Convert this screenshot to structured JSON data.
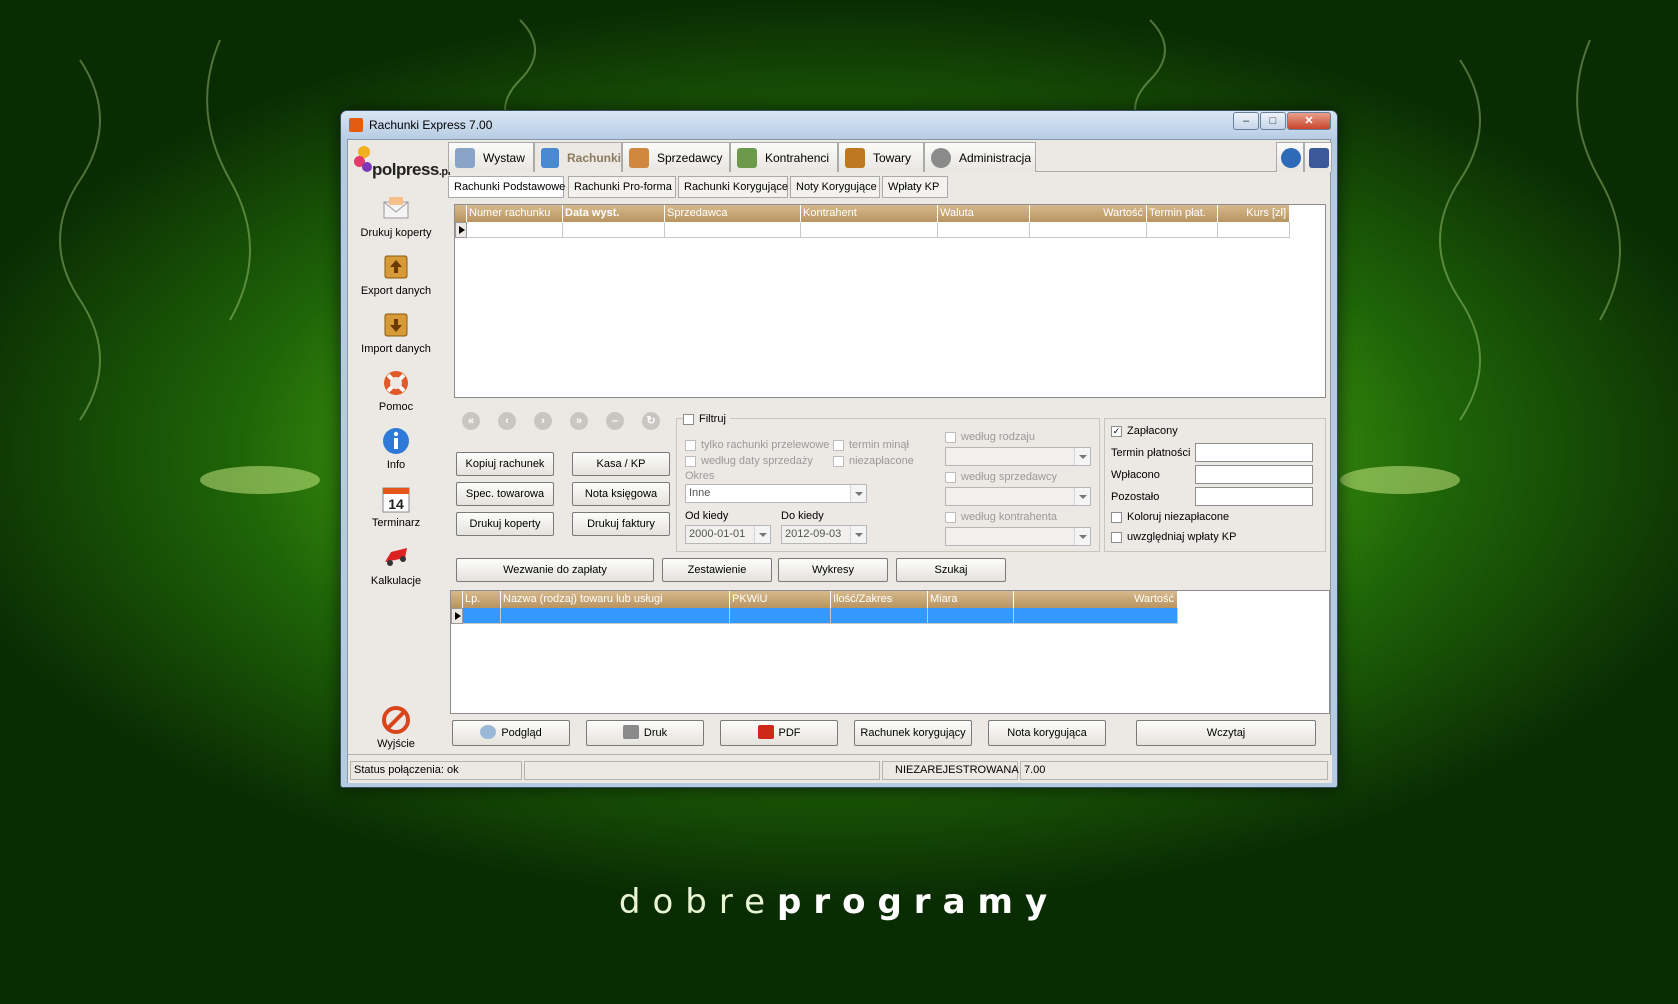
{
  "window": {
    "title": "Rachunki Express 7.00",
    "min": "–",
    "max": "□",
    "close": "✕"
  },
  "sidebar": {
    "logo": "polpress",
    "logo_suffix": ".pl",
    "items": [
      {
        "label": "Drukuj koperty",
        "icon": "envelope-icon"
      },
      {
        "label": "Export danych",
        "icon": "export-icon"
      },
      {
        "label": "Import danych",
        "icon": "import-icon"
      },
      {
        "label": "Pomoc",
        "icon": "lifebuoy-icon"
      },
      {
        "label": "Info",
        "icon": "info-icon"
      },
      {
        "label": "Terminarz",
        "icon": "calendar-icon",
        "calendar_day": "14"
      },
      {
        "label": "Kalkulacje",
        "icon": "car-icon"
      },
      {
        "label": "Wyjście",
        "icon": "exit-icon"
      }
    ]
  },
  "tabs": [
    {
      "label": "Wystaw",
      "icon": "pencil-icon",
      "color": "#8aa4c8"
    },
    {
      "label": "Rachunki",
      "icon": "book-icon",
      "color": "#4a8ad0"
    },
    {
      "label": "Sprzedawcy",
      "icon": "person-icon",
      "color": "#d08840"
    },
    {
      "label": "Kontrahenci",
      "icon": "people-icon",
      "color": "#6a9a4a"
    },
    {
      "label": "Towary",
      "icon": "box-icon",
      "color": "#c07820"
    },
    {
      "label": "Administracja",
      "icon": "gear-icon",
      "color": "#8a8a8a"
    }
  ],
  "subtabs": [
    "Rachunki Podstawowe",
    "Rachunki Pro-forma",
    "Rachunki Korygujące",
    "Noty Korygujące",
    "Wpłaty KP"
  ],
  "invoice_grid": {
    "headers": [
      "Numer rachunku",
      "Data wyst.",
      "Sprzedawca",
      "Kontrahent",
      "Waluta",
      "Wartość",
      "Termin płat.",
      "Kurs [zł]"
    ]
  },
  "nav_buttons": [
    "«",
    "‹",
    "›",
    "»",
    "–",
    "↻"
  ],
  "actions": {
    "kopiuj": "Kopiuj rachunek",
    "kasa": "Kasa / KP",
    "spec": "Spec. towarowa",
    "nota": "Nota księgowa",
    "koperty": "Drukuj koperty",
    "faktury": "Drukuj faktury",
    "wezwanie": "Wezwanie do zapłaty",
    "zestawienie": "Zestawienie",
    "wykresy": "Wykresy",
    "szukaj": "Szukaj"
  },
  "filter": {
    "title": "Filtruj",
    "tylko_przelewowe": "tylko rachunki przelewowe",
    "termin_minal": "termin minął",
    "wg_daty": "według daty sprzedaży",
    "niezaplacone": "niezapłacone",
    "okres_label": "Okres",
    "okres_value": "Inne",
    "od_label": "Od kiedy",
    "od_value": "2000-01-01",
    "do_label": "Do kiedy",
    "do_value": "2012-09-03",
    "wg_rodzaju": "według rodzaju",
    "wg_sprzedawcy": "według sprzedawcy",
    "wg_kontrahenta": "według kontrahenta"
  },
  "payment": {
    "zaplacony": "Zapłacony",
    "zaplacony_checked": "✓",
    "termin": "Termin płatności",
    "wplacono": "Wpłacono",
    "pozostalo": "Pozostało",
    "koloruj": "Koloruj niezapłacone",
    "uwzgledniaj": "uwzględniaj wpłaty KP"
  },
  "items_grid": {
    "headers": [
      "Lp.",
      "Nazwa (rodzaj) towaru lub usługi",
      "PKWiU",
      "Ilość/Zakres",
      "Miara",
      "Wartość"
    ],
    "selected_color": "#3399ff"
  },
  "bottom": {
    "podglad": "Podgląd",
    "druk": "Druk",
    "pdf": "PDF",
    "rach_kor": "Rachunek korygujący",
    "nota_kor": "Nota korygująca",
    "wczytaj": "Wczytaj"
  },
  "status": {
    "connection": "Status połączenia: ok",
    "reg": "NIEZAREJESTROWANA",
    "version": "7.00"
  },
  "brand": {
    "light": "dobre",
    "bold": "programy"
  }
}
